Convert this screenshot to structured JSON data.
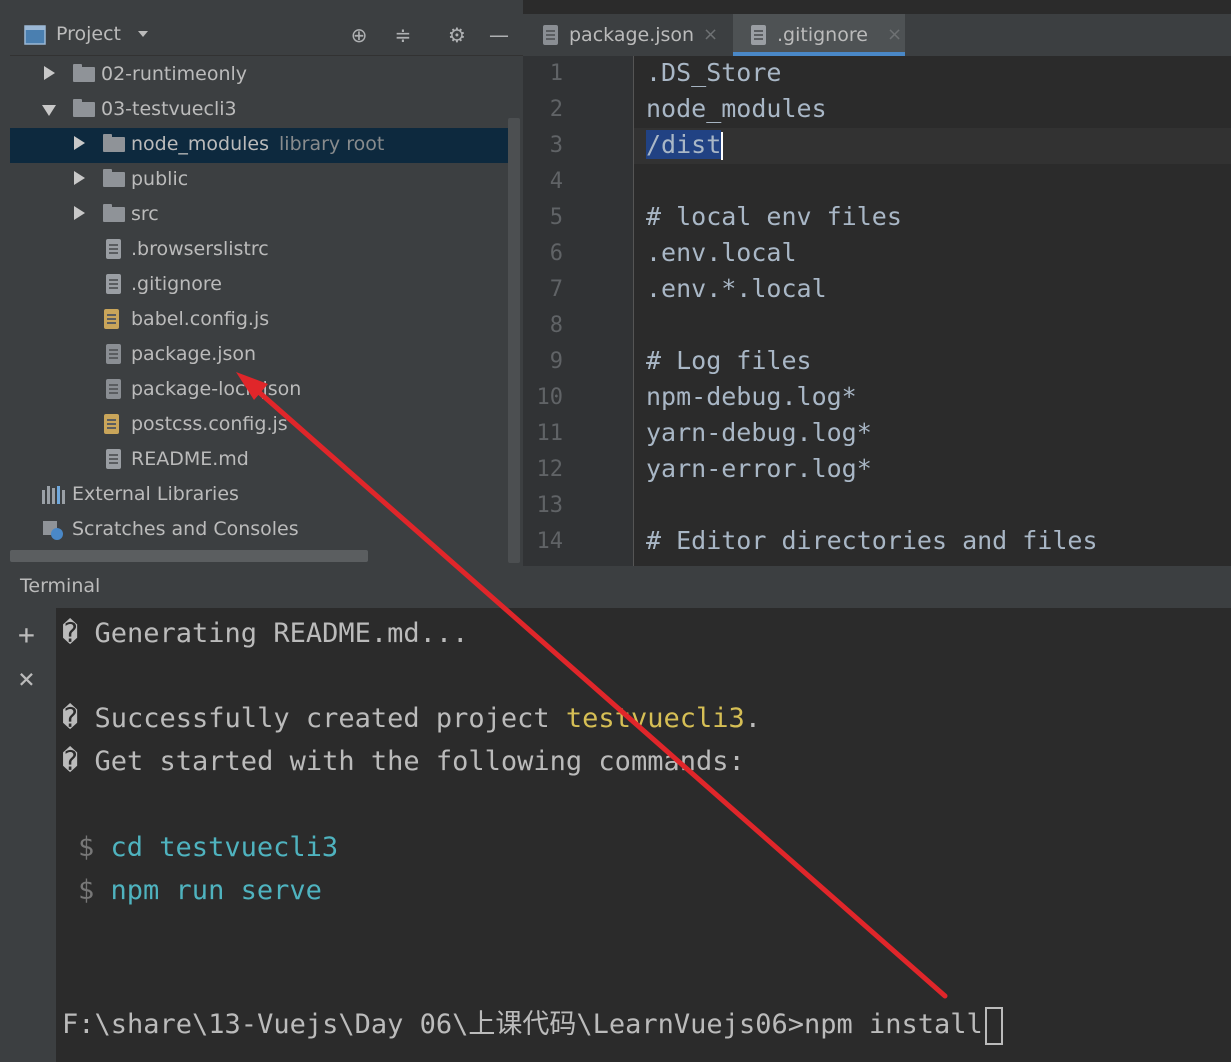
{
  "project_panel": {
    "title": "Project",
    "tree": [
      {
        "label": "02-runtimeonly",
        "kind": "folder",
        "expanded": false
      },
      {
        "label": "03-testvuecli3",
        "kind": "folder",
        "expanded": true
      },
      {
        "label": "node_modules",
        "suffix": "library root",
        "kind": "folder",
        "expanded": false,
        "selected": true
      },
      {
        "label": "public",
        "kind": "folder",
        "expanded": false
      },
      {
        "label": "src",
        "kind": "folder",
        "expanded": false
      },
      {
        "label": ".browserslistrc",
        "kind": "file"
      },
      {
        "label": ".gitignore",
        "kind": "file"
      },
      {
        "label": "babel.config.js",
        "kind": "js"
      },
      {
        "label": "package.json",
        "kind": "json"
      },
      {
        "label": "package-lock.json",
        "kind": "json"
      },
      {
        "label": "postcss.config.js",
        "kind": "js"
      },
      {
        "label": "README.md",
        "kind": "file"
      },
      {
        "label": "External Libraries",
        "kind": "library"
      },
      {
        "label": "Scratches and Consoles",
        "kind": "scratch"
      }
    ]
  },
  "editor": {
    "tabs": [
      {
        "label": "package.json",
        "active": false
      },
      {
        "label": ".gitignore",
        "active": true
      }
    ],
    "lines": [
      {
        "n": "1",
        "text": ".DS_Store"
      },
      {
        "n": "2",
        "text": "node_modules"
      },
      {
        "n": "3",
        "text": "/dist"
      },
      {
        "n": "4",
        "text": ""
      },
      {
        "n": "5",
        "text": "# local env files"
      },
      {
        "n": "6",
        "text": ".env.local"
      },
      {
        "n": "7",
        "text": ".env.*.local"
      },
      {
        "n": "8",
        "text": ""
      },
      {
        "n": "9",
        "text": "# Log files"
      },
      {
        "n": "10",
        "text": "npm-debug.log*"
      },
      {
        "n": "11",
        "text": "yarn-debug.log*"
      },
      {
        "n": "12",
        "text": "yarn-error.log*"
      },
      {
        "n": "13",
        "text": ""
      },
      {
        "n": "14",
        "text": "# Editor directories and files"
      }
    ]
  },
  "terminal": {
    "title": "Terminal",
    "add_label": "+",
    "close_label": "×",
    "lines": {
      "generating": "� Generating README.md...",
      "success_prefix": "� Successfully created project ",
      "project_name": "testvuecli3",
      "success_suffix": ".",
      "get_started": "� Get started with the following commands:",
      "dollar": "$",
      "cmd1": "cd testvuecli3",
      "cmd2": "npm run serve",
      "prompt": "F:\\share\\13-Vuejs\\Day 06\\上课代码\\LearnVuejs06>npm install"
    }
  },
  "colors": {
    "annotation_arrow": "#e0262a",
    "selection": "#214283",
    "accent": "#4a88c7"
  }
}
